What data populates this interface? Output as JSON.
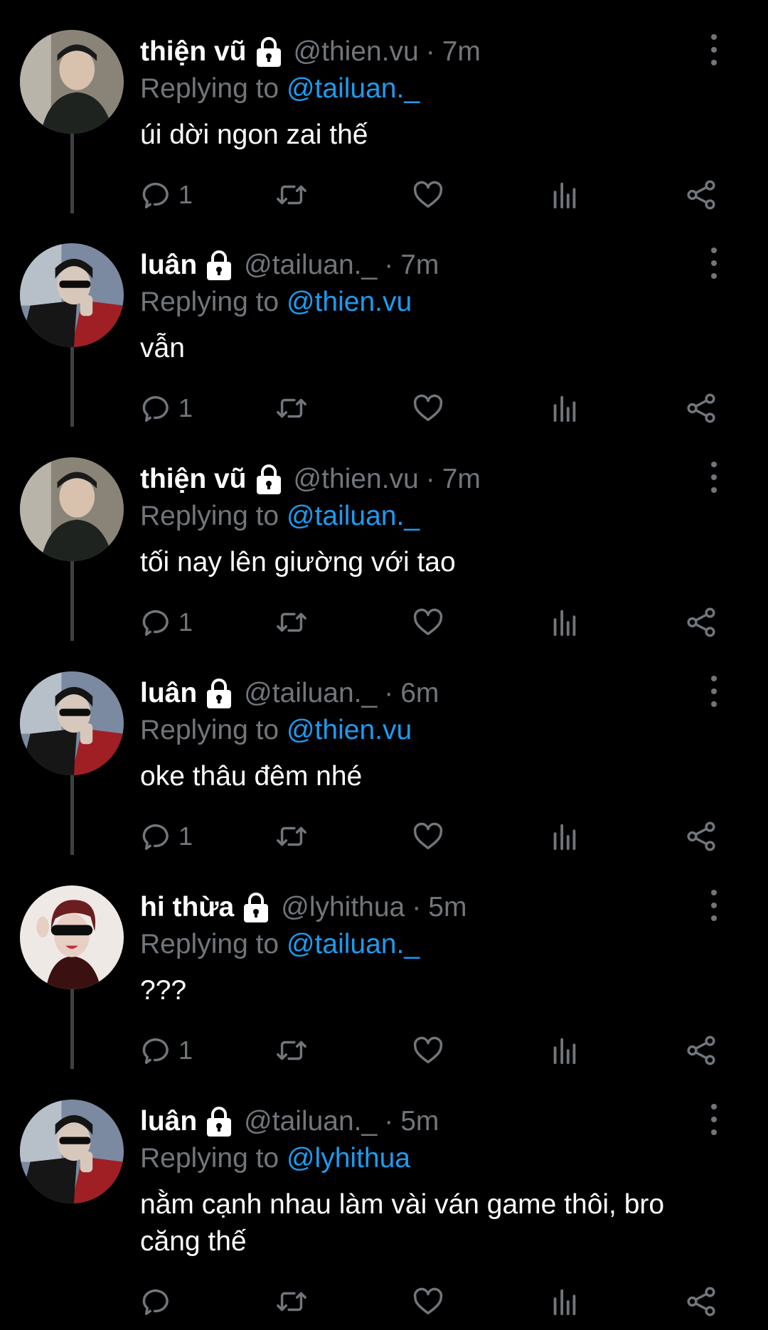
{
  "thread": {
    "replying_prefix": "Replying to",
    "tweets": [
      {
        "name": "thiện vũ",
        "handle": "@thien.vu",
        "sep": "·",
        "time": "7m",
        "replying_to": "@tailuan._",
        "text": "úi dời ngon zai thế",
        "reply_count": "1",
        "avatar": "avatar-thienvu"
      },
      {
        "name": "luân",
        "handle": "@tailuan._",
        "sep": "·",
        "time": "7m",
        "replying_to": "@thien.vu",
        "text": "vẫn",
        "reply_count": "1",
        "avatar": "avatar-luan"
      },
      {
        "name": "thiện vũ",
        "handle": "@thien.vu",
        "sep": "·",
        "time": "7m",
        "replying_to": "@tailuan._",
        "text": "tối nay lên giường với tao",
        "reply_count": "1",
        "avatar": "avatar-thienvu"
      },
      {
        "name": "luân",
        "handle": "@tailuan._",
        "sep": "·",
        "time": "6m",
        "replying_to": "@thien.vu",
        "text": "oke thâu đêm nhé",
        "reply_count": "1",
        "avatar": "avatar-luan"
      },
      {
        "name": "hi thừa",
        "handle": "@lyhithua",
        "sep": "·",
        "time": "5m",
        "replying_to": "@tailuan._",
        "text": "???",
        "reply_count": "1",
        "avatar": "avatar-hithua"
      },
      {
        "name": "luân",
        "handle": "@tailuan._",
        "sep": "·",
        "time": "5m",
        "replying_to": "@lyhithua",
        "text": "nằm cạnh nhau làm vài ván game thôi, bro căng thế",
        "reply_count": "",
        "avatar": "avatar-luan"
      }
    ]
  },
  "colors": {
    "background": "#000000",
    "text": "#ffffff",
    "muted": "#71767b",
    "mention": "#1d9bf0",
    "thread_line": "#3e4144"
  },
  "icons": [
    "lock-icon",
    "more-icon",
    "reply-icon",
    "retweet-icon",
    "like-icon",
    "views-icon",
    "share-icon"
  ]
}
